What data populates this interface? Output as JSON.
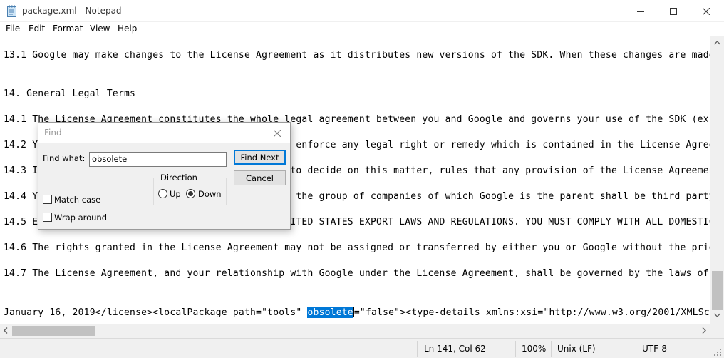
{
  "window": {
    "title": "package.xml - Notepad",
    "app_icon": "notepad-icon",
    "controls": [
      "minimize-icon",
      "maximize-icon",
      "close-icon"
    ]
  },
  "menu": {
    "items": [
      "File",
      "Edit",
      "Format",
      "View",
      "Help"
    ]
  },
  "editor": {
    "lines": [
      "13.1 Google may make changes to the License Agreement as it distributes new versions of the SDK. When these changes are made",
      "",
      "14. General Legal Terms",
      "14.1 The License Agreement constitutes the whole legal agreement between you and Google and governs your use of the SDK (exc",
      "14.2 You agree that if Google does not exercise or enforce any legal right or remedy which is contained in the License Agree",
      "14.3 If any court of law, having the jurisdiction to decide on this matter, rules that any provision of the License Agreemen",
      "14.4 You acknowledge and agree that each member of the group of companies of which Google is the parent shall be third party",
      "14.5 EXPORT RESTRICTIONS. THE SDK IS SUBJECT TO UNITED STATES EXPORT LAWS AND REGULATIONS. YOU MUST COMPLY WITH ALL DOMESTIC",
      "14.6 The rights granted in the License Agreement may not be assigned or transferred by either you or Google without the prio",
      "14.7 The License Agreement, and your relationship with Google under the License Agreement, shall be governed by the laws of",
      ""
    ],
    "last_line": {
      "before": "January 16, 2019</license><localPackage path=\"tools\" ",
      "selected": "obsolete",
      "after": "=\"false\"><type-details xmlns:xsi=\"http://www.w3.org/2001/XMLSch"
    }
  },
  "statusbar": {
    "position": "Ln 141, Col 62",
    "zoom": "100%",
    "line_ending": "Unix (LF)",
    "encoding": "UTF-8"
  },
  "find_dialog": {
    "title": "Find",
    "find_what_label": "Find what:",
    "find_what_value": "obsolete",
    "find_next_label": "Find Next",
    "cancel_label": "Cancel",
    "direction_label": "Direction",
    "up_label": "Up",
    "down_label": "Down",
    "direction_selected": "Down",
    "match_case_label": "Match case",
    "match_case_checked": false,
    "wrap_around_label": "Wrap around",
    "wrap_around_checked": false
  },
  "scroll": {
    "vertical_position": 0.9,
    "horizontal_position": 0.0
  }
}
